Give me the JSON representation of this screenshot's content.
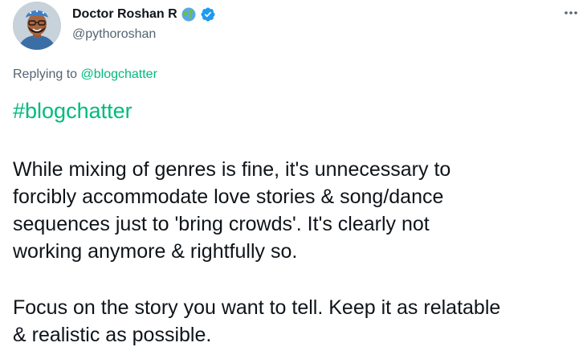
{
  "author": {
    "display_name": "Doctor Roshan R",
    "handle": "@pythoroshan",
    "badges": [
      "globe-emoji",
      "verified-badge"
    ]
  },
  "reply": {
    "prefix": "Replying to ",
    "mention": "@blogchatter"
  },
  "tweet": {
    "hashtag": "#blogchatter",
    "paragraphs": [
      "While mixing of genres is fine, it's unnecessary to\nforcibly accommodate love stories & song/dance\nsequences just to 'bring crowds'. It's clearly not\nworking anymore & rightfully so.",
      "Focus on the story you want to tell. Keep it as relatable\n& realistic as possible."
    ]
  },
  "colors": {
    "link": "#00ba7c",
    "secondary_text": "#536471",
    "verified": "#1d9bf0"
  }
}
